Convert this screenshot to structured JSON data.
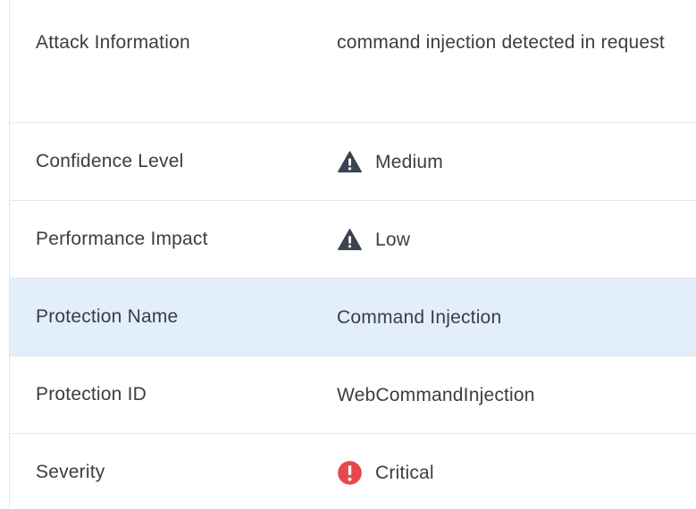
{
  "rows": [
    {
      "label": "Attack Information",
      "value": "command injection detected in request"
    },
    {
      "label": "Confidence Level",
      "value": "Medium",
      "icon": "warning-triangle-icon",
      "icon_color": "#3b4252"
    },
    {
      "label": "Performance Impact",
      "value": "Low",
      "icon": "warning-triangle-icon",
      "icon_color": "#3b4252"
    },
    {
      "label": "Protection Name",
      "value": "Command Injection",
      "highlighted": true
    },
    {
      "label": "Protection ID",
      "value": "WebCommandInjection"
    },
    {
      "label": "Severity",
      "value": "Critical",
      "icon": "critical-alert-icon",
      "icon_color": "#e5484d"
    }
  ],
  "colors": {
    "text": "#3a3d44",
    "divider": "#e4e6ea",
    "highlight_bg": "#e3eefb"
  }
}
